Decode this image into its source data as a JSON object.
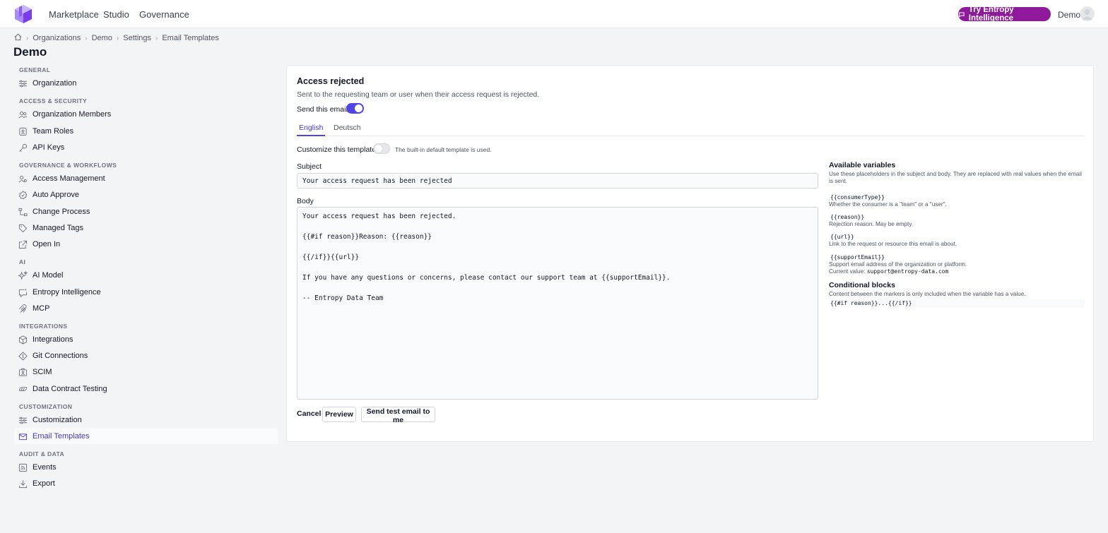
{
  "header": {
    "nav": [
      "Marketplace",
      "Studio",
      "Governance"
    ],
    "try_button": "Try Entropy Intelligence",
    "user": "Demo"
  },
  "breadcrumb": [
    "Organizations",
    "Demo",
    "Settings",
    "Email Templates"
  ],
  "page_title": "Demo",
  "sidebar": {
    "groups": [
      {
        "title": "GENERAL",
        "items": [
          "Organization"
        ]
      },
      {
        "title": "ACCESS & SECURITY",
        "items": [
          "Organization Members",
          "Team Roles",
          "API Keys"
        ]
      },
      {
        "title": "GOVERNANCE & WORKFLOWS",
        "items": [
          "Access Management",
          "Auto Approve",
          "Change Process",
          "Managed Tags",
          "Open In"
        ]
      },
      {
        "title": "AI",
        "items": [
          "AI Model",
          "Entropy Intelligence",
          "MCP"
        ]
      },
      {
        "title": "INTEGRATIONS",
        "items": [
          "Integrations",
          "Git Connections",
          "SCIM",
          "Data Contract Testing"
        ]
      },
      {
        "title": "CUSTOMIZATION",
        "items": [
          "Customization",
          "Email Templates"
        ]
      },
      {
        "title": "AUDIT & DATA",
        "items": [
          "Events",
          "Export"
        ]
      }
    ],
    "active": "Email Templates"
  },
  "template": {
    "title": "Access rejected",
    "description": "Sent to the requesting team or user when their access request is rejected.",
    "send_label": "Send this email",
    "send_enabled": true,
    "tabs": [
      "English",
      "Deutsch"
    ],
    "active_tab": "English",
    "customize_label": "Customize this template",
    "customize_enabled": false,
    "customize_hint": "The built-in default template is used.",
    "subject_label": "Subject",
    "subject_value": "Your access request has been rejected",
    "body_label": "Body",
    "body_lines": [
      "Your access request has been rejected.",
      "",
      "{{#if reason}}Reason: {{reason}}",
      "",
      "{{/if}}{{url}}",
      "",
      "If you have any questions or concerns, please contact our support team at {{supportEmail}}.",
      "",
      "-- Entropy Data Team"
    ],
    "buttons": {
      "cancel": "Cancel",
      "preview": "Preview",
      "send_test": "Send test email to me"
    }
  },
  "variables": {
    "title": "Available variables",
    "intro": "Use these placeholders in the subject and body. They are replaced with real values when the email is sent.",
    "items": [
      {
        "code": "{{consumerType}}",
        "desc": "Whether the consumer is a \"team\" or a \"user\"."
      },
      {
        "code": "{{reason}}",
        "desc": "Rejection reason. May be empty."
      },
      {
        "code": "{{url}}",
        "desc": "Link to the request or resource this email is about."
      },
      {
        "code": "{{supportEmail}}",
        "desc": "Support email address of the organization or platform.",
        "current_label": "Current value:",
        "current_value": "support@entropy-data.com"
      }
    ],
    "conditional_title": "Conditional blocks",
    "conditional_desc": "Content between the markers is only included when the variable has a value.",
    "conditional_code": "{{#if reason}}...{{/if}}"
  },
  "colors": {
    "accent": "#4f46e5",
    "brand": "#8e1a9b"
  }
}
